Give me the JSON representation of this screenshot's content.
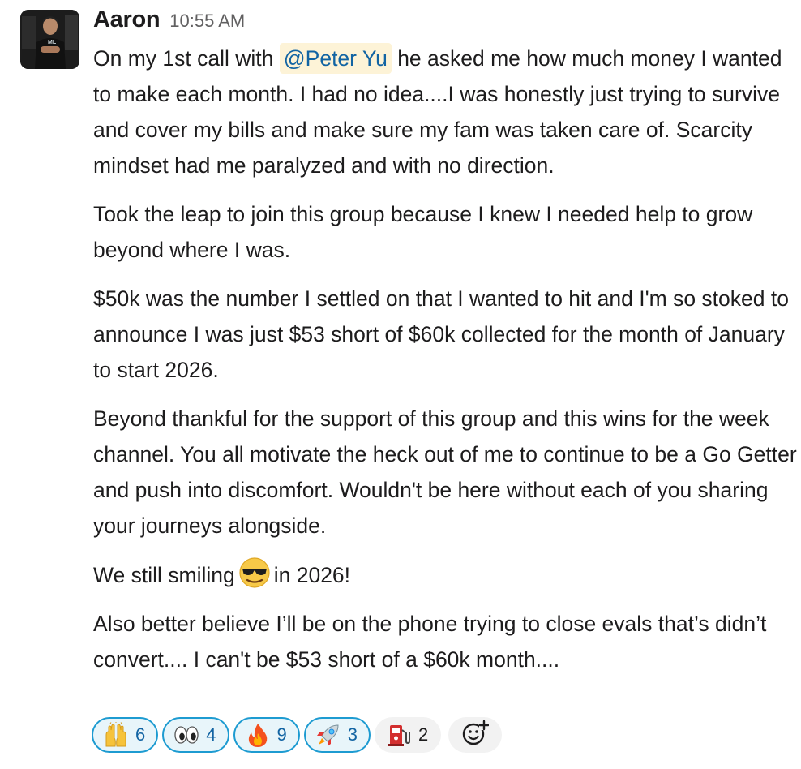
{
  "message": {
    "sender": "Aaron",
    "timestamp": "10:55 AM",
    "mention": "@Peter Yu",
    "p1_before": "On my 1st call with",
    "p1_after": " he asked me how much money I wanted to make each month. I had no idea....I was honestly just trying to survive and cover my bills and make sure my fam was taken care of. Scarcity mindset had me paralyzed and with no direction.",
    "p2": "Took the leap to join this group because I knew I needed help to grow beyond where I was.",
    "p3": "$50k was the number I settled on that I wanted to hit and I'm so stoked to announce I was just $53 short of $60k collected for the month of January to start 2026.",
    "p4": "Beyond thankful for the support of this group and this wins for the week channel. You all motivate the heck out of me to continue to be a Go Getter and push into discomfort. Wouldn't be here without each of you sharing your journeys alongside.",
    "p5_before": "We still smiling",
    "p5_after": "in 2026!",
    "p6": "Also better believe I’ll be on the phone trying to close evals that’s didn’t convert.... I can't be $53 short of a $60k month...."
  },
  "reactions": [
    {
      "icon": "raised-hands-icon",
      "count": "6",
      "reacted_by_me": true
    },
    {
      "icon": "eyes-icon",
      "count": "4",
      "reacted_by_me": true
    },
    {
      "icon": "fire-icon",
      "count": "9",
      "reacted_by_me": true
    },
    {
      "icon": "rocket-icon",
      "count": "3",
      "reacted_by_me": true
    },
    {
      "icon": "fuel-pump-icon",
      "count": "2",
      "reacted_by_me": false
    }
  ],
  "colors": {
    "mention_bg": "#fdf3d7",
    "mention_text": "#1264a3",
    "reaction_mine_border": "#1d9bd1",
    "reaction_mine_bg": "#e8f5fa"
  }
}
